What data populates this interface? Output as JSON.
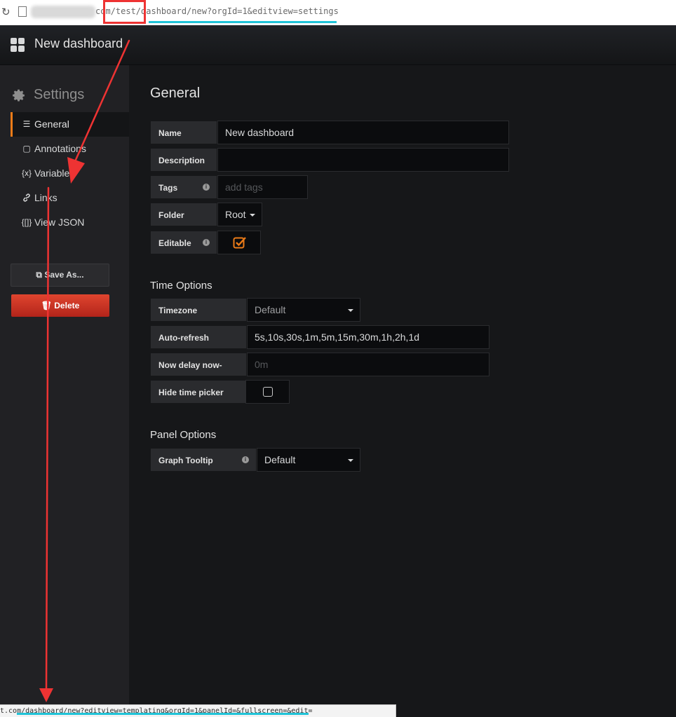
{
  "browser": {
    "reload_icon": "reload-icon",
    "url_host_suffix": "com",
    "url_path": "/test/dashboard/new?orgId=1&editview=settings",
    "status_url": "t.com/dashboard/new?editview=templating&orgId=1&panelId=&fullscreen=&edit="
  },
  "navbar": {
    "title": "New dashboard",
    "icon": "dashboard-grid-icon"
  },
  "sidebar": {
    "title": "Settings",
    "items": [
      {
        "label": "General",
        "icon": "sliders-icon",
        "glyph": "☰",
        "active": true
      },
      {
        "label": "Annotations",
        "icon": "comment-icon",
        "glyph": "▢"
      },
      {
        "label": "Variables",
        "icon": "variable-icon",
        "glyph": "{x}"
      },
      {
        "label": "Links",
        "icon": "link-icon",
        "glyph": "🔗"
      },
      {
        "label": "View JSON",
        "icon": "json-icon",
        "glyph": "{[]}"
      }
    ],
    "save_as_label": "Save As...",
    "delete_label": "Delete"
  },
  "general": {
    "title": "General",
    "name_label": "Name",
    "name_value": "New dashboard",
    "description_label": "Description",
    "description_value": "",
    "tags_label": "Tags",
    "tags_placeholder": "add tags",
    "folder_label": "Folder",
    "folder_value": "Root",
    "editable_label": "Editable",
    "editable_checked": true
  },
  "time_options": {
    "title": "Time Options",
    "timezone_label": "Timezone",
    "timezone_value": "Default",
    "autorefresh_label": "Auto-refresh",
    "autorefresh_value": "5s,10s,30s,1m,5m,15m,30m,1h,2h,1d",
    "nowdelay_label": "Now delay now-",
    "nowdelay_placeholder": "0m",
    "hidepicker_label": "Hide time picker",
    "hidepicker_checked": false
  },
  "panel_options": {
    "title": "Panel Options",
    "tooltip_label": "Graph Tooltip",
    "tooltip_value": "Default"
  },
  "colors": {
    "accent": "#eb7b18",
    "delete": "#d44a3a",
    "annotation": "#ee3333",
    "highlight": "#20c4d8"
  }
}
